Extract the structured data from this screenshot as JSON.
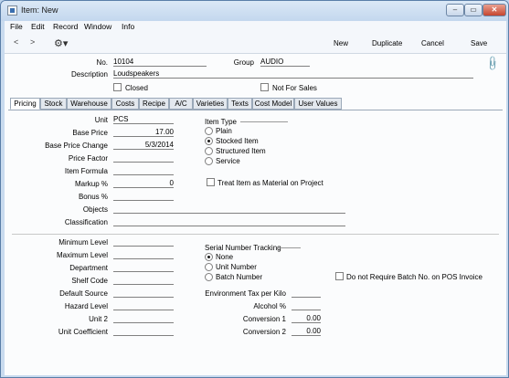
{
  "window": {
    "title": "Item: New",
    "min": "–",
    "max": "▭",
    "close": "✕"
  },
  "menu": [
    "File",
    "Edit",
    "Record",
    "Window",
    "Info"
  ],
  "toolbar": {
    "prev": "<",
    "next": ">",
    "gear": "⚙▾",
    "new": "New",
    "duplicate": "Duplicate",
    "cancel": "Cancel",
    "save": "Save"
  },
  "header": {
    "no_label": "No.",
    "no_value": "10104",
    "group_label": "Group",
    "group_value": "AUDIO",
    "description_label": "Description",
    "description_value": "Loudspeakers",
    "closed_label": "Closed",
    "not_for_sales_label": "Not For Sales"
  },
  "tabs": [
    "Pricing",
    "Stock",
    "Warehouse",
    "Costs",
    "Recipe",
    "A/C",
    "Varieties",
    "Texts",
    "Cost Model",
    "User Values"
  ],
  "pricing": {
    "unit_label": "Unit",
    "unit_value": "PCS",
    "base_price_label": "Base Price",
    "base_price_value": "17.00",
    "base_price_change_label": "Base Price Change",
    "base_price_change_value": "5/3/2014",
    "price_factor_label": "Price Factor",
    "price_factor_value": "",
    "item_formula_label": "Item Formula",
    "item_formula_value": "",
    "markup_label": "Markup %",
    "markup_value": "0",
    "bonus_label": "Bonus %",
    "bonus_value": "",
    "objects_label": "Objects",
    "objects_value": "",
    "classification_label": "Classification",
    "classification_value": "",
    "item_type_label": "Item Type",
    "item_types": [
      "Plain",
      "Stocked Item",
      "Structured Item",
      "Service"
    ],
    "item_type_selected": "Stocked Item",
    "treat_label": "Treat Item as Material on Project"
  },
  "lower": {
    "minimum_level_label": "Minimum Level",
    "maximum_level_label": "Maximum Level",
    "department_label": "Department",
    "shelf_code_label": "Shelf Code",
    "default_source_label": "Default Source",
    "hazard_level_label": "Hazard Level",
    "unit2_label": "Unit 2",
    "unit_coefficient_label": "Unit Coefficient",
    "serial_label": "Serial Number Tracking",
    "serial_options": [
      "None",
      "Unit Number",
      "Batch Number"
    ],
    "serial_selected": "None",
    "no_batch_label": "Do not Require Batch No. on POS Invoice",
    "env_tax_label": "Environment Tax per Kilo",
    "env_tax_value": "",
    "alcohol_label": "Alcohol %",
    "alcohol_value": "",
    "conversion1_label": "Conversion 1",
    "conversion1_value": "0.00",
    "conversion2_label": "Conversion 2",
    "conversion2_value": "0.00"
  }
}
